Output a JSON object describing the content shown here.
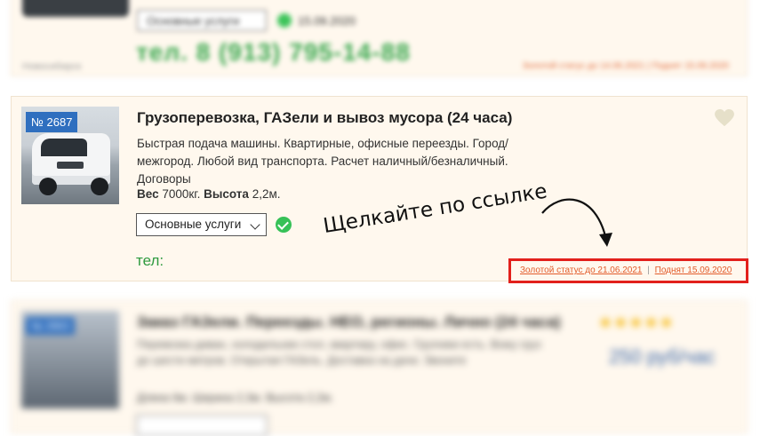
{
  "top_card": {
    "service_select": "Основные услуги",
    "date": "15.09.2020",
    "phone": "тел. 8 (913) 795-14-88",
    "city": "Новосибирск",
    "status": "Золотой статус до 14.06.2021 | Поднят 15.09.2020"
  },
  "main_card": {
    "badge": "№ 2687",
    "title": "Грузоперевозка, ГАЗели и вывоз мусора (24 часа)",
    "description": "Быстрая подача машины. Квартирные, офисные переезды. Город/межгород. Любой вид транспорта. Расчет наличный/безналичный. Договоры",
    "specs": {
      "weight_label": "Вес",
      "weight_value": "7000кг.",
      "height_label": "Высота",
      "height_value": "2,2м."
    },
    "service_select": "Основные услуги",
    "phone_label": "тел:",
    "status_link": "Золотой статус до 21.06.2021",
    "separator": "|",
    "raised_link": "Поднят 15.09.2020"
  },
  "annotation": {
    "text": "Щелкайте по ссылке"
  },
  "bottom_card": {
    "badge": "№ 2663",
    "title": "Заказ ГАЗели. Переезды. НЕО, регионы. Лично (24 часа)",
    "stars": "★★★★★",
    "description": "Перевозка диван, холодильник стол, квартиру, офис. Грузчики есть. Вожу груз до шести метров. Открытая ГАЗель. Доставка на дачи. Звоните",
    "price": "250 руб/час",
    "specs": "Длина 6м. Ширина 2,3м. Высота 2,2м."
  },
  "colors": {
    "card_bg": "#fff8ee",
    "highlight_border": "#e2201c",
    "link": "#e25b2a",
    "phone_green": "#2e9a3f",
    "badge_blue": "#2f6fbf"
  }
}
